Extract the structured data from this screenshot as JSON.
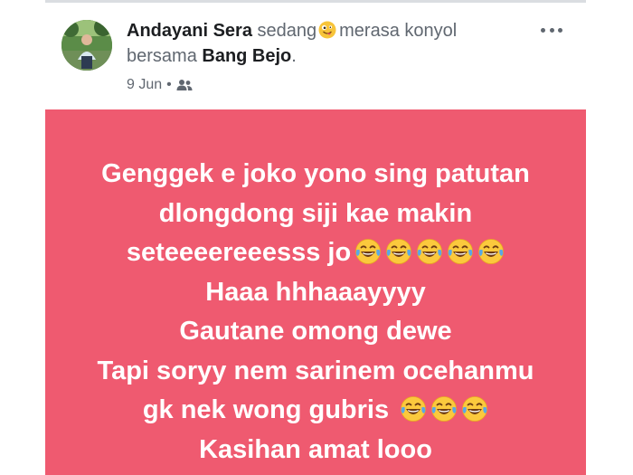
{
  "post": {
    "author": "Andayani Sera",
    "activity_verb": "sedang",
    "feeling_icon": "silly-face-icon",
    "feeling": "merasa konyol",
    "with_word": "bersama",
    "tagged": "Bang Bejo",
    "period": ".",
    "date": "9 Jun",
    "separator": "•",
    "audience_icon": "friends-icon",
    "menu_icon": "more-options-icon"
  },
  "card": {
    "background": "#ef5a70",
    "text_color": "#ffffff",
    "lines": [
      "Genggek e joko yono sing patutan",
      "dlongdong siji kae makin",
      "seteeeereeesss jo",
      "Haaa hhhaaayyyy",
      "Gautane omong dewe",
      "Tapi soryy nem sarinem ocehanmu",
      "gk nek wong gubris",
      "Kasihan amat looo"
    ],
    "emoji_name": "face-with-tears-of-joy-icon"
  }
}
